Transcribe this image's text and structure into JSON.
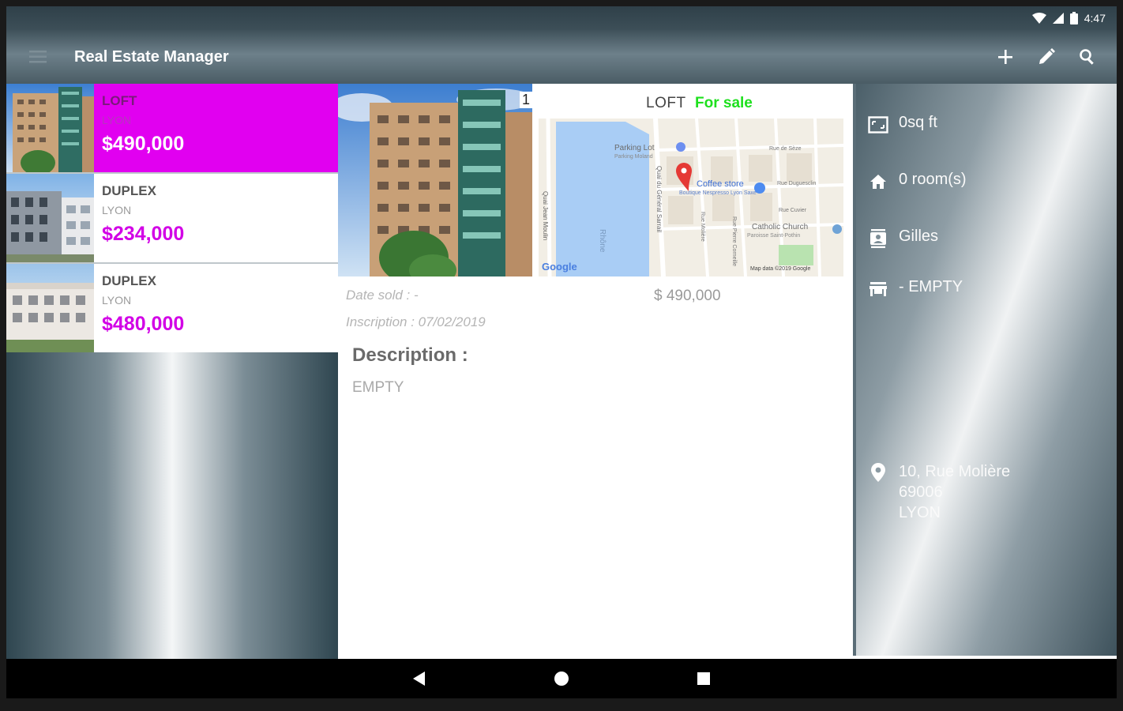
{
  "status_bar": {
    "time": "4:47"
  },
  "toolbar": {
    "title": "Real Estate Manager",
    "menu_icon": "menu-icon",
    "add_icon": "add-icon",
    "edit_icon": "edit-icon",
    "search_icon": "search-icon"
  },
  "colors": {
    "accent": "#E100F0",
    "price": "#D200E6",
    "status_green": "#1EE01E"
  },
  "list": {
    "items": [
      {
        "type": "LOFT",
        "city": "LYON",
        "price": "$490,000",
        "selected": true
      },
      {
        "type": "DUPLEX",
        "city": "LYON",
        "price": "$234,000",
        "selected": false
      },
      {
        "type": "DUPLEX",
        "city": "LYON",
        "price": "$480,000",
        "selected": false
      }
    ]
  },
  "detail": {
    "photo_index": "1",
    "type": "LOFT",
    "status": "For sale",
    "date_sold": "Date sold :  -",
    "price": "$ 490,000",
    "inscription": "Inscription :  07/02/2019",
    "description_title": "Description :",
    "description_value": "EMPTY",
    "map": {
      "labels": {
        "parking": "Parking Lot",
        "parking_sub": "Parking Moland",
        "store": "Coffee store",
        "store_sub": "Boutique Nespresso Lyon Saxe",
        "church": "Catholic Church",
        "church_sub": "Paroisse Saint-Pothin",
        "street1": "Quai du Général Sarrail",
        "street2": "Quai Jean Moulin",
        "river": "Rhône",
        "rue1": "Rue de Sèze",
        "rue2": "Rue Duguesclin",
        "rue3": "Rue Cuvier",
        "rue4": "Rue Molière",
        "rue5": "Rue Pierre Corneille",
        "google": "Google",
        "credit": "Map data ©2019 Google"
      }
    }
  },
  "info": {
    "surface": "0sq ft",
    "rooms": "0 room(s)",
    "agent": "Gilles",
    "poi": "- EMPTY",
    "address": [
      "10, Rue Molière",
      "69006",
      "LYON"
    ]
  },
  "nav": {
    "back_icon": "back-icon",
    "home_icon": "home-icon",
    "recents_icon": "recents-icon"
  }
}
